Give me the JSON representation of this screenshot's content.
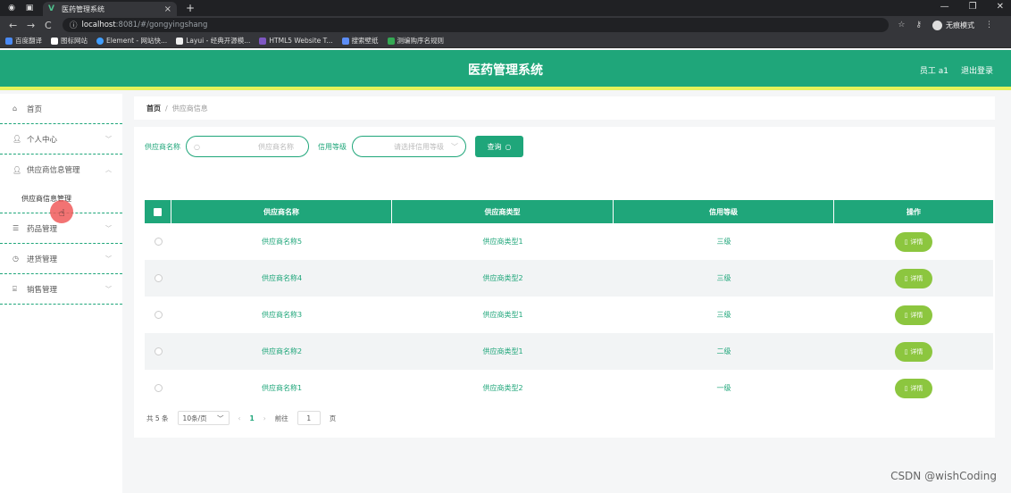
{
  "browser": {
    "tab_title": "医药管理系统",
    "url_host": "localhost",
    "url_path": ":8081/#/gongyingshang",
    "incognito_label": "无痕模式",
    "bookmarks": [
      "百度翻译",
      "图标网站",
      "Element - 网站快...",
      "Layui - 经典开源模...",
      "HTML5 Website T...",
      "搜索壁纸",
      "测编购序名规则"
    ]
  },
  "header": {
    "title": "医药管理系统",
    "user": "员工 a1",
    "logout": "退出登录"
  },
  "sidebar": {
    "items": [
      {
        "label": "首页",
        "icon": "home-icon"
      },
      {
        "label": "个人中心",
        "icon": "person-icon"
      },
      {
        "label": "供应商信息管理",
        "icon": "person-icon"
      },
      {
        "label": "供应商信息管理",
        "icon": ""
      },
      {
        "label": "药品管理",
        "icon": "list-icon"
      },
      {
        "label": "进货管理",
        "icon": "clock-icon"
      },
      {
        "label": "销售管理",
        "icon": "bank-icon"
      }
    ]
  },
  "breadcrumb": {
    "home": "首页",
    "sep": "/",
    "current": "供应商信息"
  },
  "search": {
    "name_label": "供应商名称",
    "name_placeholder": "供应商名称",
    "level_label": "信用等级",
    "level_placeholder": "请选择信用等级",
    "button": "查询"
  },
  "table": {
    "headers": [
      "供应商名称",
      "供应商类型",
      "信用等级",
      "操作"
    ],
    "rows": [
      {
        "name": "供应商名称5",
        "type": "供应商类型1",
        "level": "三级",
        "action": "详情"
      },
      {
        "name": "供应商名称4",
        "type": "供应商类型2",
        "level": "三级",
        "action": "详情"
      },
      {
        "name": "供应商名称3",
        "type": "供应商类型1",
        "level": "三级",
        "action": "详情"
      },
      {
        "name": "供应商名称2",
        "type": "供应商类型1",
        "level": "二级",
        "action": "详情"
      },
      {
        "name": "供应商名称1",
        "type": "供应商类型2",
        "level": "一级",
        "action": "详情"
      }
    ]
  },
  "pager": {
    "total": "共 5 条",
    "size": "10条/页",
    "page": "1",
    "goto": "前往",
    "goto_value": "1",
    "unit": "页"
  },
  "watermark": "CSDN @wishCoding",
  "colors": {
    "primary": "#1fa67a",
    "accent": "#e6f25a",
    "detail": "#8cc63f"
  }
}
